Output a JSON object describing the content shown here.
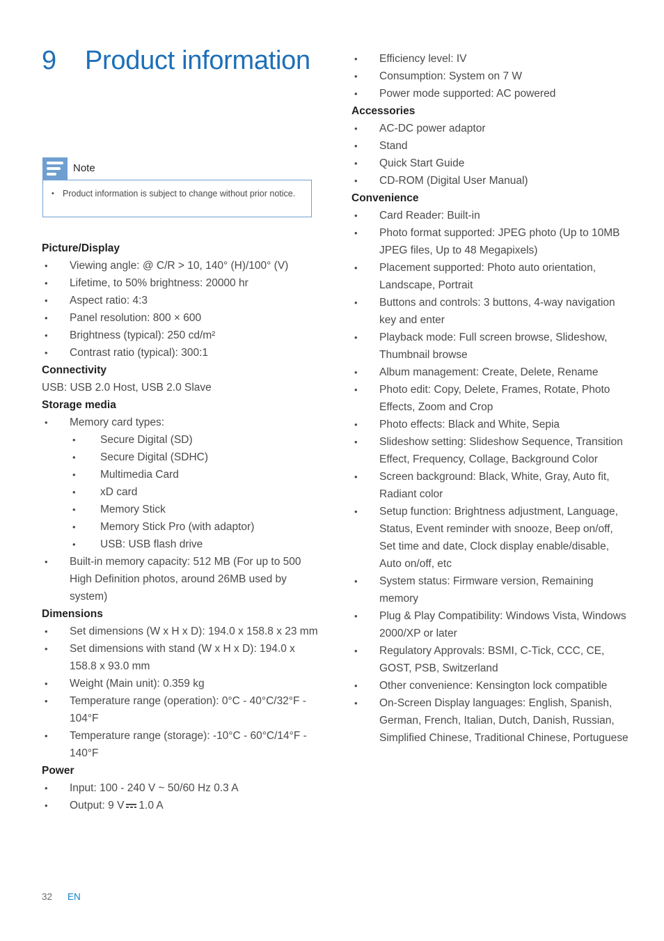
{
  "chapter": {
    "number": "9",
    "title": "Product information"
  },
  "note": {
    "icon": "note-lines-icon",
    "label": "Note",
    "bullet": "•",
    "items": [
      "Product information is subject to change without prior notice."
    ]
  },
  "colors": {
    "heading_blue": "#1d6fb8",
    "note_blue": "#6f9fd0",
    "lang_blue": "#0b80cc",
    "body_gray": "#4a4a4a"
  },
  "bullets": {
    "level1": "•",
    "level2": "•"
  },
  "left_column": {
    "sections": [
      {
        "heading": "Picture/Display",
        "items": [
          "Viewing angle: @ C/R > 10, 140° (H)/100° (V)",
          "Lifetime, to 50% brightness: 20000 hr",
          "Aspect ratio: 4:3",
          "Panel resolution: 800 × 600",
          "Brightness (typical): 250 cd/m²",
          "Contrast ratio (typical): 300:1"
        ]
      },
      {
        "heading": "Connectivity",
        "plain": "USB: USB 2.0 Host, USB 2.0 Slave",
        "items": []
      },
      {
        "heading": "Storage media",
        "items": [
          "Memory card types:"
        ],
        "subitems": [
          "Secure Digital (SD)",
          "Secure Digital (SDHC)",
          "Multimedia Card",
          "xD card",
          "Memory Stick",
          "Memory Stick Pro (with adaptor)",
          "USB: USB flash drive"
        ],
        "items_after": [
          "Built-in memory capacity: 512 MB (For up to 500 High Definition photos, around 26MB used by system)"
        ]
      },
      {
        "heading": "Dimensions",
        "items": [
          "Set dimensions (W x H x D): 194.0 x 158.8 x 23 mm",
          "Set dimensions with stand (W x H x D): 194.0 x 158.8 x 93.0 mm",
          "Weight (Main unit): 0.359 kg",
          "Temperature range (operation): 0°C - 40°C/32°F - 104°F",
          "Temperature range (storage): -10°C - 60°C/14°F - 140°F"
        ]
      },
      {
        "heading": "Power",
        "items": [
          "Input: 100 - 240 V ~ 50/60 Hz 0.3 A"
        ],
        "output_prefix": "Output: 9 V",
        "output_symbol": "dc-current-icon",
        "output_suffix": "1.0 A"
      }
    ]
  },
  "right_column": {
    "power_continued": [
      "Efficiency level: IV",
      "Consumption: System on 7 W",
      "Power mode supported: AC powered"
    ],
    "sections": [
      {
        "heading": "Accessories",
        "items": [
          "AC-DC power adaptor",
          "Stand",
          "Quick Start Guide",
          "CD-ROM (Digital User Manual)"
        ]
      },
      {
        "heading": "Convenience",
        "items": [
          "Card Reader: Built-in",
          "Photo format supported: JPEG photo (Up to 10MB JPEG files, Up to 48 Megapixels)",
          "Placement supported: Photo auto orientation, Landscape, Portrait",
          "Buttons and controls: 3 buttons, 4-way navigation key and enter",
          "Playback mode: Full screen browse, Slideshow, Thumbnail browse",
          "Album management: Create, Delete, Rename",
          "Photo edit: Copy, Delete, Frames, Rotate, Photo Effects, Zoom and Crop",
          "Photo effects: Black and White, Sepia",
          "Slideshow setting: Slideshow Sequence, Transition Effect, Frequency, Collage, Background Color",
          "Screen background: Black, White, Gray, Auto fit, Radiant color",
          "Setup function: Brightness adjustment, Language, Status, Event reminder with snooze, Beep on/off, Set time and date, Clock display enable/disable, Auto on/off, etc",
          "System status: Firmware version, Remaining memory",
          "Plug & Play Compatibility: Windows Vista, Windows 2000/XP or later",
          "Regulatory Approvals: BSMI, C-Tick, CCC, CE, GOST, PSB, Switzerland",
          "Other convenience: Kensington lock compatible",
          "On-Screen Display languages: English, Spanish, German, French, Italian, Dutch, Danish, Russian, Simplified Chinese, Traditional Chinese, Portuguese"
        ]
      }
    ]
  },
  "footer": {
    "page_number": "32",
    "language": "EN"
  }
}
